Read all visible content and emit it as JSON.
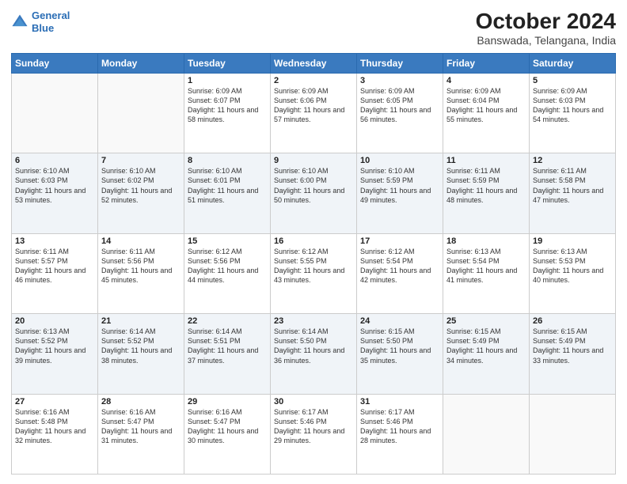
{
  "header": {
    "logo_line1": "General",
    "logo_line2": "Blue",
    "title": "October 2024",
    "subtitle": "Banswada, Telangana, India"
  },
  "weekdays": [
    "Sunday",
    "Monday",
    "Tuesday",
    "Wednesday",
    "Thursday",
    "Friday",
    "Saturday"
  ],
  "weeks": [
    [
      {
        "day": "",
        "info": ""
      },
      {
        "day": "",
        "info": ""
      },
      {
        "day": "1",
        "info": "Sunrise: 6:09 AM\nSunset: 6:07 PM\nDaylight: 11 hours and 58 minutes."
      },
      {
        "day": "2",
        "info": "Sunrise: 6:09 AM\nSunset: 6:06 PM\nDaylight: 11 hours and 57 minutes."
      },
      {
        "day": "3",
        "info": "Sunrise: 6:09 AM\nSunset: 6:05 PM\nDaylight: 11 hours and 56 minutes."
      },
      {
        "day": "4",
        "info": "Sunrise: 6:09 AM\nSunset: 6:04 PM\nDaylight: 11 hours and 55 minutes."
      },
      {
        "day": "5",
        "info": "Sunrise: 6:09 AM\nSunset: 6:03 PM\nDaylight: 11 hours and 54 minutes."
      }
    ],
    [
      {
        "day": "6",
        "info": "Sunrise: 6:10 AM\nSunset: 6:03 PM\nDaylight: 11 hours and 53 minutes."
      },
      {
        "day": "7",
        "info": "Sunrise: 6:10 AM\nSunset: 6:02 PM\nDaylight: 11 hours and 52 minutes."
      },
      {
        "day": "8",
        "info": "Sunrise: 6:10 AM\nSunset: 6:01 PM\nDaylight: 11 hours and 51 minutes."
      },
      {
        "day": "9",
        "info": "Sunrise: 6:10 AM\nSunset: 6:00 PM\nDaylight: 11 hours and 50 minutes."
      },
      {
        "day": "10",
        "info": "Sunrise: 6:10 AM\nSunset: 5:59 PM\nDaylight: 11 hours and 49 minutes."
      },
      {
        "day": "11",
        "info": "Sunrise: 6:11 AM\nSunset: 5:59 PM\nDaylight: 11 hours and 48 minutes."
      },
      {
        "day": "12",
        "info": "Sunrise: 6:11 AM\nSunset: 5:58 PM\nDaylight: 11 hours and 47 minutes."
      }
    ],
    [
      {
        "day": "13",
        "info": "Sunrise: 6:11 AM\nSunset: 5:57 PM\nDaylight: 11 hours and 46 minutes."
      },
      {
        "day": "14",
        "info": "Sunrise: 6:11 AM\nSunset: 5:56 PM\nDaylight: 11 hours and 45 minutes."
      },
      {
        "day": "15",
        "info": "Sunrise: 6:12 AM\nSunset: 5:56 PM\nDaylight: 11 hours and 44 minutes."
      },
      {
        "day": "16",
        "info": "Sunrise: 6:12 AM\nSunset: 5:55 PM\nDaylight: 11 hours and 43 minutes."
      },
      {
        "day": "17",
        "info": "Sunrise: 6:12 AM\nSunset: 5:54 PM\nDaylight: 11 hours and 42 minutes."
      },
      {
        "day": "18",
        "info": "Sunrise: 6:13 AM\nSunset: 5:54 PM\nDaylight: 11 hours and 41 minutes."
      },
      {
        "day": "19",
        "info": "Sunrise: 6:13 AM\nSunset: 5:53 PM\nDaylight: 11 hours and 40 minutes."
      }
    ],
    [
      {
        "day": "20",
        "info": "Sunrise: 6:13 AM\nSunset: 5:52 PM\nDaylight: 11 hours and 39 minutes."
      },
      {
        "day": "21",
        "info": "Sunrise: 6:14 AM\nSunset: 5:52 PM\nDaylight: 11 hours and 38 minutes."
      },
      {
        "day": "22",
        "info": "Sunrise: 6:14 AM\nSunset: 5:51 PM\nDaylight: 11 hours and 37 minutes."
      },
      {
        "day": "23",
        "info": "Sunrise: 6:14 AM\nSunset: 5:50 PM\nDaylight: 11 hours and 36 minutes."
      },
      {
        "day": "24",
        "info": "Sunrise: 6:15 AM\nSunset: 5:50 PM\nDaylight: 11 hours and 35 minutes."
      },
      {
        "day": "25",
        "info": "Sunrise: 6:15 AM\nSunset: 5:49 PM\nDaylight: 11 hours and 34 minutes."
      },
      {
        "day": "26",
        "info": "Sunrise: 6:15 AM\nSunset: 5:49 PM\nDaylight: 11 hours and 33 minutes."
      }
    ],
    [
      {
        "day": "27",
        "info": "Sunrise: 6:16 AM\nSunset: 5:48 PM\nDaylight: 11 hours and 32 minutes."
      },
      {
        "day": "28",
        "info": "Sunrise: 6:16 AM\nSunset: 5:47 PM\nDaylight: 11 hours and 31 minutes."
      },
      {
        "day": "29",
        "info": "Sunrise: 6:16 AM\nSunset: 5:47 PM\nDaylight: 11 hours and 30 minutes."
      },
      {
        "day": "30",
        "info": "Sunrise: 6:17 AM\nSunset: 5:46 PM\nDaylight: 11 hours and 29 minutes."
      },
      {
        "day": "31",
        "info": "Sunrise: 6:17 AM\nSunset: 5:46 PM\nDaylight: 11 hours and 28 minutes."
      },
      {
        "day": "",
        "info": ""
      },
      {
        "day": "",
        "info": ""
      }
    ]
  ]
}
